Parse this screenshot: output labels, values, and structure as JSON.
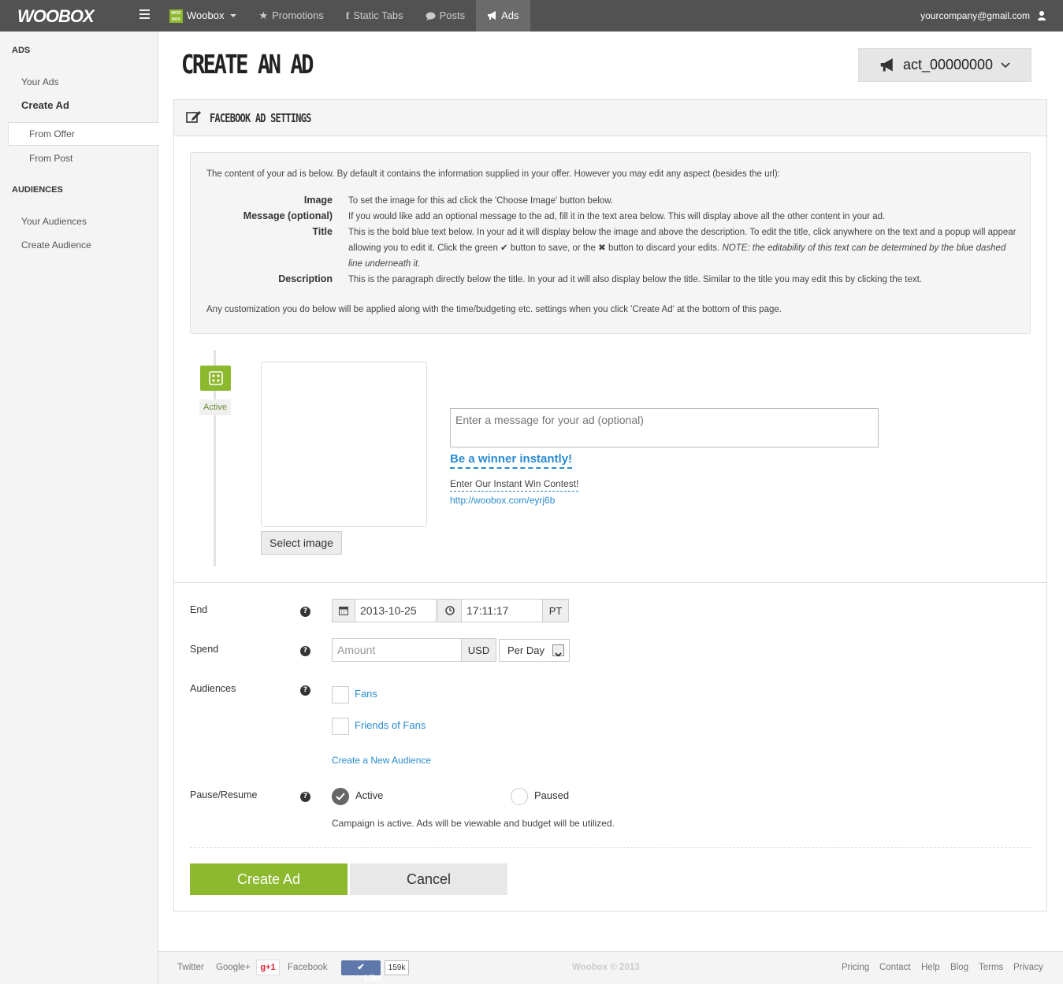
{
  "topbar": {
    "logo": "WOOBOX",
    "nav": [
      {
        "label": "Woobox",
        "icon": "woobox-logo-icon"
      },
      {
        "label": "Promotions",
        "icon": "star-icon"
      },
      {
        "label": "Static Tabs",
        "icon": "facebook-icon"
      },
      {
        "label": "Posts",
        "icon": "comment-icon"
      },
      {
        "label": "Ads",
        "icon": "bullhorn-icon"
      }
    ],
    "user_email": "yourcompany@gmail.com"
  },
  "sidebar": {
    "ads_heading": "ADS",
    "your_ads": "Your Ads",
    "create_ad": "Create Ad",
    "from_offer": "From Offer",
    "from_post": "From Post",
    "audiences_heading": "AUDIENCES",
    "your_audiences": "Your Audiences",
    "create_audience": "Create Audience"
  },
  "page_title": "CREATE AN AD",
  "account_selector": "act_00000000",
  "panel": {
    "title": "FACEBOOK AD SETTINGS",
    "info_intro": "The content of your ad is below. By default it contains the information supplied in your offer. However you may edit any aspect (besides the url):",
    "fields": [
      {
        "label": "Image",
        "desc": "To set the image for this ad click the 'Choose Image' button below."
      },
      {
        "label": "Message (optional)",
        "desc": "If you would like add an optional message to the ad, fill it in the text area below. This will display above all the other content in your ad."
      },
      {
        "label": "Title",
        "desc": "This is the bold blue text below. In your ad it will display below the image and above the description. To edit the title, click anywhere on the text and a popup will appear allowing you to edit it. Click the green ✔ button to save, or the ✖ button to discard your edits.",
        "note": "NOTE: the editability of this text can be determined by the blue dashed line underneath it."
      },
      {
        "label": "Description",
        "desc": "This is the paragraph directly below the title. In your ad it will also display below the title. Similar to the title you may edit this by clicking the text."
      }
    ],
    "info_footer": "Any customization you do below will be applied along with the time/budgeting etc. settings when you click 'Create Ad' at the bottom of this page."
  },
  "ad_preview": {
    "status": "Active",
    "select_image": "Select image",
    "message_placeholder": "Enter a message for your ad (optional)",
    "title": "Be a winner instantly!",
    "description": "Enter Our Instant Win Contest!",
    "url": "http://woobox.com/eyrj6b"
  },
  "form": {
    "end_label": "End",
    "end_date": "2013-10-25",
    "end_time": "17:11:17",
    "timezone": "PT",
    "spend_label": "Spend",
    "amount_placeholder": "Amount",
    "currency": "USD",
    "period": "Per Day",
    "audiences_label": "Audiences",
    "audience_fans": "Fans",
    "audience_friends": "Friends of Fans",
    "create_audience_link": "Create a New Audience",
    "pause_label": "Pause/Resume",
    "active_label": "Active",
    "paused_label": "Paused",
    "status_note": "Campaign is active. Ads will be viewable and budget will be utilized.",
    "create_button": "Create Ad",
    "cancel_button": "Cancel"
  },
  "footer": {
    "twitter": "Twitter",
    "googleplus": "Google+",
    "gplus_button": "g+1",
    "facebook": "Facebook",
    "like_button": "Like",
    "like_count": "159k",
    "copyright": "Woobox © 2013",
    "links": [
      "Pricing",
      "Contact",
      "Help",
      "Blog",
      "Terms",
      "Privacy"
    ]
  }
}
